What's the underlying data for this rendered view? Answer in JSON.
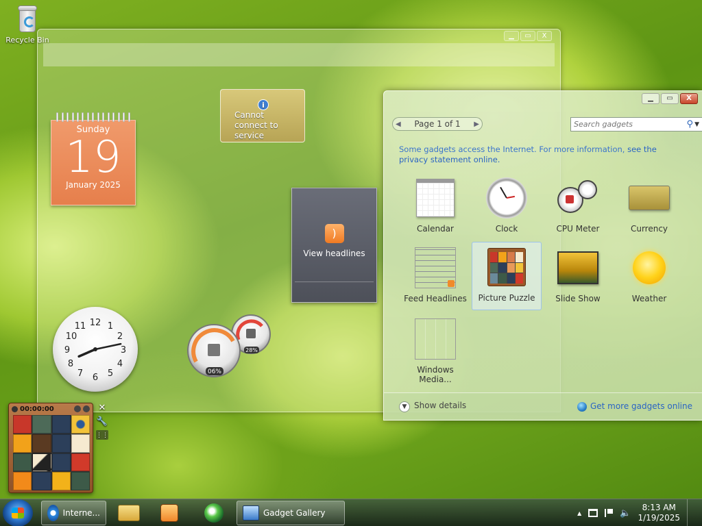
{
  "desktop": {
    "recycle_bin_label": "Recycle Bin"
  },
  "calendar_gadget": {
    "weekday": "Sunday",
    "day": "19",
    "month_year": "January 2025"
  },
  "currency_gadget": {
    "message": "Cannot connect to service",
    "info_symbol": "i"
  },
  "feed_gadget": {
    "label": "View headlines",
    "rss_symbol": ")"
  },
  "clock_gadget": {
    "hour_12": "12",
    "hour_1": "1",
    "hour_2": "2",
    "hour_3": "3",
    "hour_4": "4",
    "hour_5": "5",
    "hour_6": "6",
    "hour_7": "7",
    "hour_8": "8",
    "hour_9": "9",
    "hour_10": "10",
    "hour_11": "11",
    "time_hours": 8,
    "time_minutes": 13
  },
  "cpu_gadget": {
    "cpu_percent": "06%",
    "memory_percent": "28%"
  },
  "puzzle_gadget": {
    "timer": "00:00:00"
  },
  "gadget_gallery": {
    "page_indicator": "Page 1 of 1",
    "search_placeholder": "Search gadgets",
    "notice_text": "Some gadgets access the Internet.  For more information, ",
    "notice_link": "see the privacy statement online.",
    "items": [
      {
        "label": "Calendar"
      },
      {
        "label": "Clock"
      },
      {
        "label": "CPU Meter"
      },
      {
        "label": "Currency"
      },
      {
        "label": "Feed Headlines"
      },
      {
        "label": "Picture Puzzle"
      },
      {
        "label": "Slide Show"
      },
      {
        "label": "Weather"
      },
      {
        "label": "Windows Media..."
      }
    ],
    "selected_item": "Picture Puzzle",
    "show_details_label": "Show details",
    "more_gadgets_label": "Get more gadgets online",
    "minimize_glyph": "▁",
    "maximize_glyph": "▭",
    "close_glyph": "X"
  },
  "taskbar": {
    "ie_label": "Interne...",
    "gallery_label": "Gadget Gallery",
    "time": "8:13 AM",
    "date": "1/19/2025",
    "tray_up_arrow": "▲"
  },
  "colors": {
    "calendar_orange": "#e88a57",
    "link_blue": "#2a64c4",
    "taskbar": "#1e2a24"
  }
}
